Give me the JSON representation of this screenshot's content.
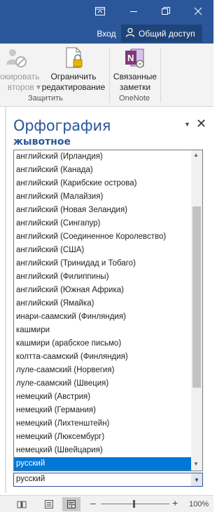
{
  "titlebar": {
    "signin_label": "Вход",
    "share_label": "Общий доступ",
    "bg_color": "#2b579a"
  },
  "ribbon": {
    "protect_item": {
      "line1": "окировать",
      "line2": "второв",
      "dropdown": "▾"
    },
    "restrict_item": {
      "line1": "Ограничить",
      "line2": "редактирование"
    },
    "linked_notes_item": {
      "line1": "Связанные",
      "line2": "заметки"
    },
    "group_protect_label": "Защитить",
    "group_onenote_label": "OneNote"
  },
  "pane": {
    "title": "Орфография",
    "misspelled_word": "жывотное",
    "menu_glyph": "▼",
    "close_glyph": "✕"
  },
  "language_list": {
    "items": [
      "английский (Ирландия)",
      "английский (Канада)",
      "английский (Карибские острова)",
      "английский (Малайзия)",
      "английский (Новая Зеландия)",
      "английский (Сингапур)",
      "английский (Соединенное Королевство)",
      "английский (США)",
      "английский (Тринидад и Тобаго)",
      "английский (Филиппины)",
      "английский (Южная Африка)",
      "английский (Ямайка)",
      "инари-саамский (Финляндия)",
      "кашмири",
      "кашмири (арабское письмо)",
      "колтта-саамский (Финляндия)",
      "луле-саамский (Норвегия)",
      "луле-саамский (Швеция)",
      "немецкий (Австрия)",
      "немецкий (Германия)",
      "немецкий (Лихтенштейн)",
      "немецкий (Люксембург)",
      "немецкий (Швейцария)",
      "русский"
    ],
    "selected": "русский",
    "scroll_up": "▲",
    "scroll_down": "▼"
  },
  "language_combo": {
    "value": "русский",
    "arrow": "▼"
  },
  "statusbar": {
    "zoom_minus": "–",
    "zoom_plus": "+",
    "zoom_level": "100%"
  }
}
